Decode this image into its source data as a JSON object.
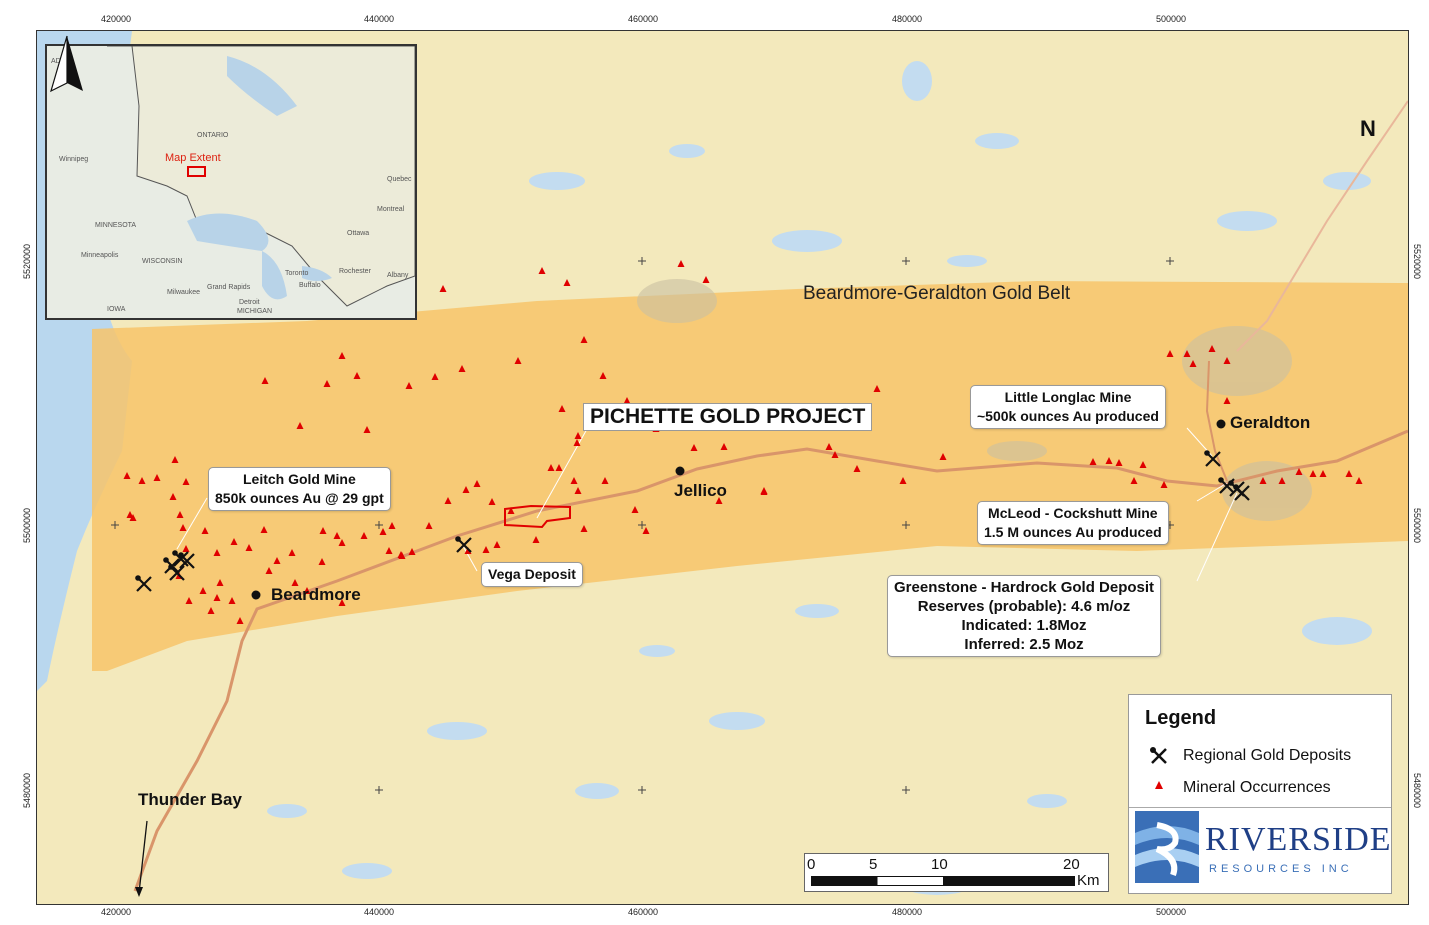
{
  "coords": {
    "top": [
      "420000",
      "440000",
      "460000",
      "480000",
      "500000"
    ],
    "bottom": [
      "420000",
      "440000",
      "460000",
      "480000",
      "500000"
    ],
    "left": [
      "5520000",
      "5500000",
      "5480000"
    ],
    "right": [
      "5520000",
      "5500000",
      "5480000"
    ]
  },
  "map": {
    "project_title": "PICHETTE GOLD PROJECT",
    "belt_label": "Beardmore-Geraldton Gold Belt",
    "places": {
      "beardmore": "Beardmore",
      "jellico": "Jellico",
      "geraldton": "Geraldton",
      "thunder_bay": "Thunder Bay"
    },
    "callouts": {
      "leitch": [
        "Leitch Gold Mine",
        "850k ounces Au @ 29 gpt"
      ],
      "vega": [
        "Vega Deposit"
      ],
      "little_longlac": [
        "Little Longlac Mine",
        "~500k ounces Au produced"
      ],
      "mcleod": [
        "McLeod - Cockshutt Mine",
        "1.5 M ounces Au produced"
      ],
      "greenstone": [
        "Greenstone - Hardrock Gold Deposit",
        "Reserves (probable): 4.6 m/oz",
        "Indicated: 1.8Moz",
        "Inferred: 2.5 Moz"
      ]
    },
    "colors": {
      "belt": "#f7c46a",
      "background": "#f3e9bc",
      "water": "#b9d7ee",
      "occurrence": "#e00000",
      "road": "#d9956a",
      "project_outline": "#e00000"
    }
  },
  "inset": {
    "map_extent_label": "Map Extent",
    "labels": [
      "ADA",
      "Winnipeg",
      "ONTARIO",
      "MINNESOTA",
      "WISCONSIN",
      "Minneapolis",
      "Milwaukee",
      "Grand Rapids",
      "Detroit",
      "IOWA",
      "MICHIGAN",
      "Toronto",
      "Buffalo",
      "Rochester",
      "Ottawa",
      "Montreal",
      "Quebec",
      "Albany"
    ]
  },
  "legend": {
    "title": "Legend",
    "items": [
      {
        "symbol": "pick-axe-icon",
        "label": "Regional Gold Deposits"
      },
      {
        "symbol": "red-triangle-icon",
        "label": "Mineral Occurrences"
      }
    ],
    "logo_main": "RIVERSIDE",
    "logo_sub": "RESOURCES INC"
  },
  "scalebar": {
    "labels": [
      "0",
      "5",
      "10",
      "20"
    ],
    "unit": "Km"
  },
  "north_arrow": {
    "label": "N"
  }
}
